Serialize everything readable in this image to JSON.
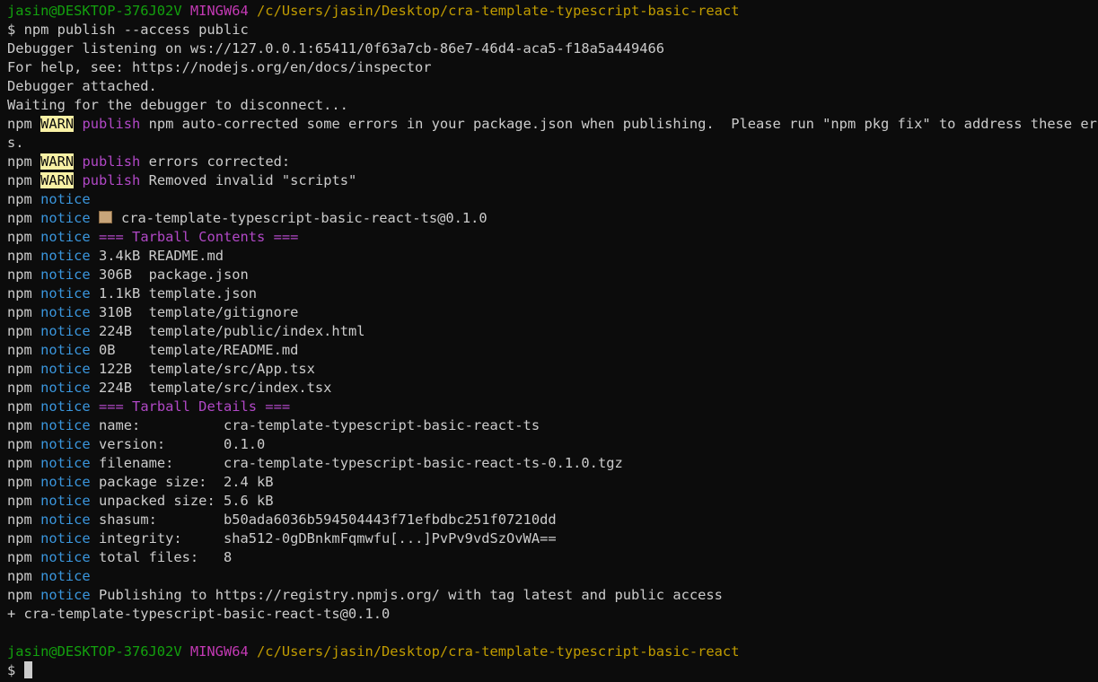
{
  "prompt": {
    "user_host": "jasin@DESKTOP-376J02V",
    "shell": "MINGW64",
    "cwd": "/c/Users/jasin/Desktop/cra-template-typescript-basic-react",
    "symbol": "$"
  },
  "command": "npm publish --access public",
  "intro_lines": [
    "Debugger listening on ws://127.0.0.1:65411/0f63a7cb-86e7-46d4-aca5-f18a5a449466",
    "For help, see: https://nodejs.org/en/docs/inspector",
    "Debugger attached.",
    "Waiting for the debugger to disconnect..."
  ],
  "npm_prefix": "npm",
  "warn_label": "WARN",
  "notice_label": "notice",
  "publish_label": "publish",
  "warnings": {
    "w1": "npm auto-corrected some errors in your package.json when publishing.  Please run \"npm pkg fix\" to address these error",
    "w1_wrap": "s.",
    "w2": "errors corrected:",
    "w3": "Removed invalid \"scripts\""
  },
  "package_icon": "package-icon",
  "package_id": "cra-template-typescript-basic-react-ts@0.1.0",
  "contents_header": "=== Tarball Contents ===",
  "files": [
    "3.4kB README.md",
    "306B  package.json",
    "1.1kB template.json",
    "310B  template/gitignore",
    "224B  template/public/index.html",
    "0B    template/README.md",
    "122B  template/src/App.tsx",
    "224B  template/src/index.tsx"
  ],
  "details_header": "=== Tarball Details ===",
  "details": [
    "name:          cra-template-typescript-basic-react-ts",
    "version:       0.1.0",
    "filename:      cra-template-typescript-basic-react-ts-0.1.0.tgz",
    "package size:  2.4 kB",
    "unpacked size: 5.6 kB",
    "shasum:        b50ada6036b594504443f71efbdbc251f07210dd",
    "integrity:     sha512-0gDBnkmFqmwfu[...]PvPv9vdSzOvWA==",
    "total files:   8"
  ],
  "publishing_line": "Publishing to https://registry.npmjs.org/ with tag latest and public access",
  "result_line": "+ cra-template-typescript-basic-react-ts@0.1.0",
  "colors": {
    "background": "#0c0c0c",
    "foreground": "#cccccc",
    "prompt_green": "#13a10e",
    "shell_magenta": "#c239b3",
    "cwd_yellow": "#c19c00",
    "notice_cyan": "#3a96dd",
    "warn_bg": "#f9f1a5"
  }
}
